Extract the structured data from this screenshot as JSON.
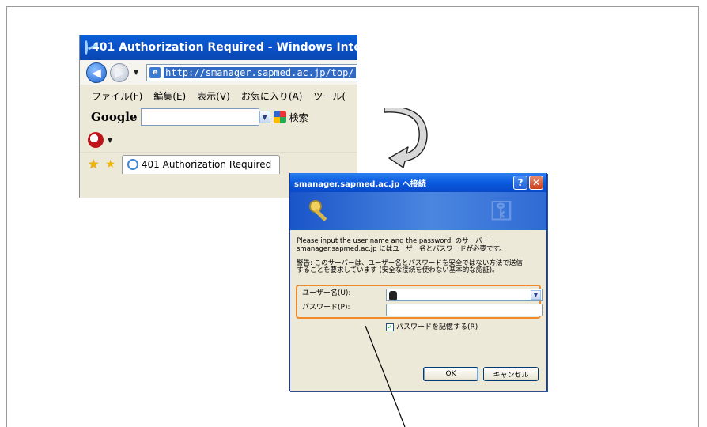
{
  "ie_window": {
    "title": "401 Authorization Required - Windows Inte",
    "url": "http://smanager.sapmed.ac.jp/top/",
    "menu": [
      "ファイル(F)",
      "編集(E)",
      "表示(V)",
      "お気に入り(A)",
      "ツール("
    ],
    "google_label": "Google",
    "search_label": "検索",
    "tab_label": "401 Authorization Required"
  },
  "dialog": {
    "title": "smanager.sapmed.ac.jp へ接続",
    "help_label": "?",
    "close_label": "✕",
    "message_line1": "Please input the user name and the password. のサーバー",
    "message_line2": "smanager.sapmed.ac.jp にはユーザー名とパスワードが必要です。",
    "warning_line1": "警告: このサーバーは、ユーザー名とパスワードを安全ではない方法で送信",
    "warning_line2": "することを要求しています (安全な接続を使わない基本的な認証)。",
    "username_label": "ユーザー名(U):",
    "password_label": "パスワード(P):",
    "remember_label": "パスワードを記憶する(R)",
    "ok_label": "OK",
    "cancel_label": "キャンセル"
  },
  "colors": {
    "highlight": "#ef8a2c",
    "xp_title_blue": "#0b5ae0"
  }
}
